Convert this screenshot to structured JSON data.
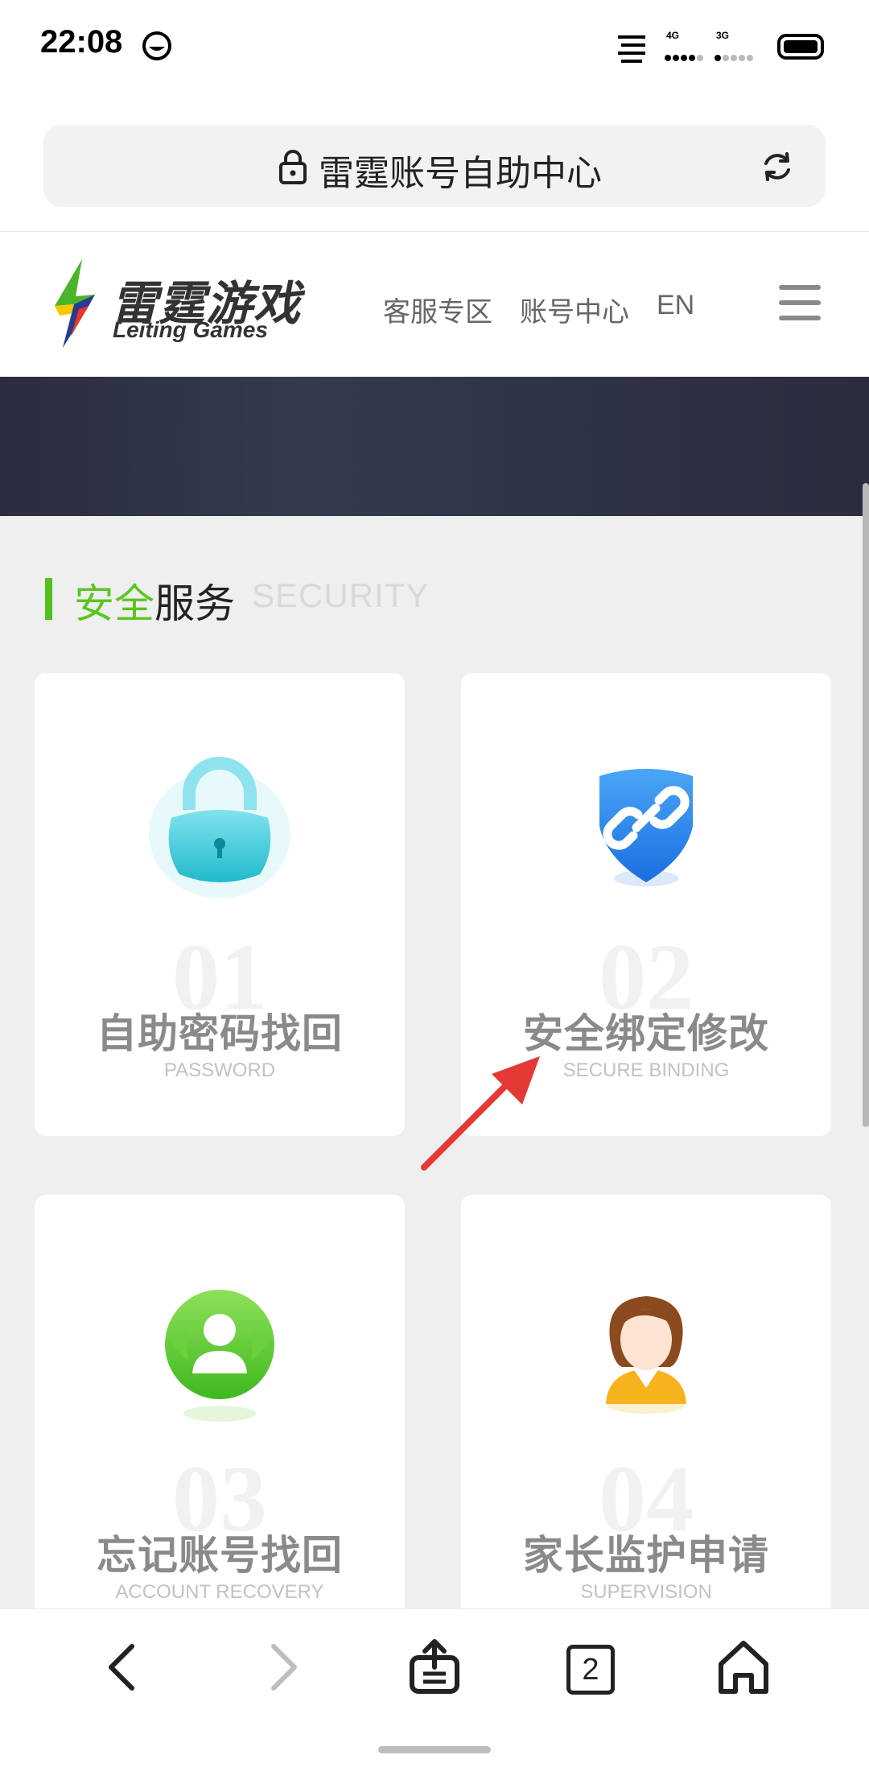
{
  "status_bar": {
    "time": "22:08",
    "net1": "4G",
    "net2": "3G"
  },
  "browser": {
    "page_title": "雷霆账号自助中心",
    "tabs_count": "2"
  },
  "site_header": {
    "logo_cn": "雷霆游戏",
    "logo_en": "Leiting Games",
    "nav": [
      "客服专区",
      "账号中心",
      "EN"
    ]
  },
  "section": {
    "title_green": "安全",
    "title_rest": "服务",
    "title_en": "SECURITY"
  },
  "cards": [
    {
      "num": "01",
      "title": "自助密码找回",
      "subtitle": "PASSWORD",
      "icon": "lock-icon"
    },
    {
      "num": "02",
      "title": "安全绑定修改",
      "subtitle": "SECURE BINDING",
      "icon": "shield-link-icon"
    },
    {
      "num": "03",
      "title": "忘记账号找回",
      "subtitle": "ACCOUNT RECOVERY",
      "icon": "user-recover-icon"
    },
    {
      "num": "04",
      "title": "家长监护申请",
      "subtitle": "SUPERVISION",
      "icon": "parent-icon"
    }
  ],
  "colors": {
    "accent_green": "#5ac61f",
    "banner_dark": "#2e3245",
    "arrow_red": "#e53935"
  }
}
